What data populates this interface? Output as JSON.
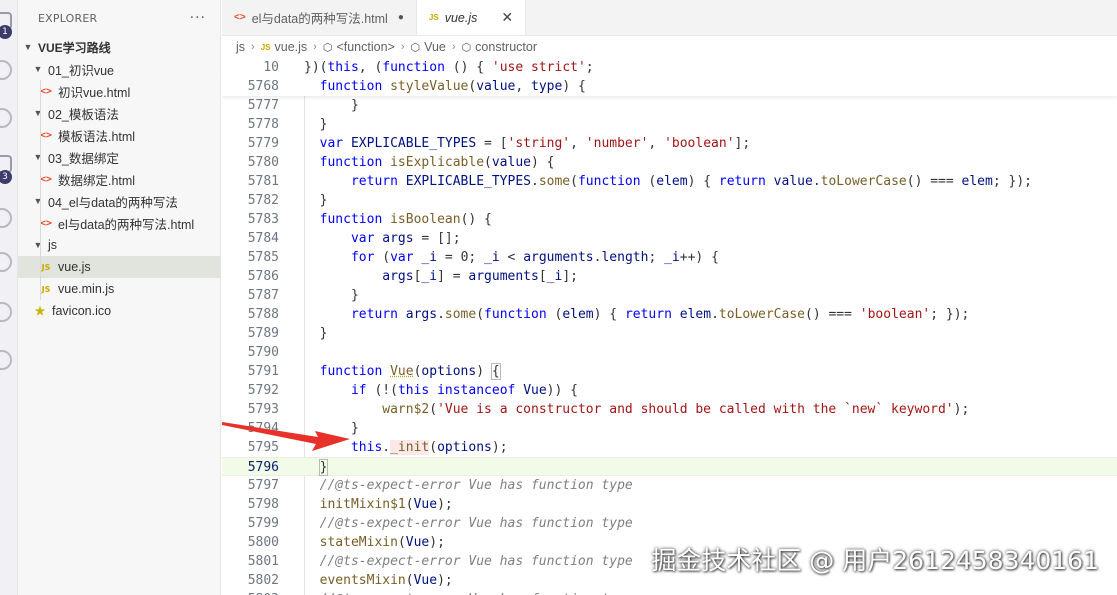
{
  "activity_bar": {
    "badges": [
      "1",
      "3"
    ]
  },
  "explorer": {
    "title": "EXPLORER",
    "more": "···",
    "root": "VUE学习路线",
    "items": [
      {
        "type": "folder",
        "label": "01_初识vue",
        "depth": 1
      },
      {
        "type": "html",
        "label": "初识vue.html",
        "depth": 2
      },
      {
        "type": "folder",
        "label": "02_模板语法",
        "depth": 1
      },
      {
        "type": "html",
        "label": "模板语法.html",
        "depth": 2
      },
      {
        "type": "folder",
        "label": "03_数据绑定",
        "depth": 1
      },
      {
        "type": "html",
        "label": "数据绑定.html",
        "depth": 2
      },
      {
        "type": "folder",
        "label": "04_el与data的两种写法",
        "depth": 1
      },
      {
        "type": "html",
        "label": "el与data的两种写法.html",
        "depth": 2
      },
      {
        "type": "folder",
        "label": "js",
        "depth": 1
      },
      {
        "type": "js",
        "label": "vue.js",
        "depth": 2,
        "selected": true
      },
      {
        "type": "js",
        "label": "vue.min.js",
        "depth": 2
      },
      {
        "type": "star",
        "label": "favicon.ico",
        "depth": 1
      }
    ]
  },
  "tabs": [
    {
      "label": "el与data的两种写法.html",
      "icon": "<>",
      "modified_marker": "●"
    },
    {
      "label": "vue.js",
      "icon": "JS",
      "close": "✕",
      "active": true
    }
  ],
  "breadcrumb": [
    "js",
    "vue.js",
    "<function>",
    "Vue",
    "constructor"
  ],
  "code": {
    "current_line": "5796",
    "lines": [
      {
        "n": "10",
        "t": "})(this, (function () { 'use strict';"
      },
      {
        "n": "5768",
        "t": "  function styleValue(value, type) {"
      },
      {
        "n": "5777",
        "t": "      }"
      },
      {
        "n": "5778",
        "t": "  }"
      },
      {
        "n": "5779",
        "t": "  var EXPLICABLE_TYPES = ['string', 'number', 'boolean'];"
      },
      {
        "n": "5780",
        "t": "  function isExplicable(value) {"
      },
      {
        "n": "5781",
        "t": "      return EXPLICABLE_TYPES.some(function (elem) { return value.toLowerCase() === elem; });"
      },
      {
        "n": "5782",
        "t": "  }"
      },
      {
        "n": "5783",
        "t": "  function isBoolean() {"
      },
      {
        "n": "5784",
        "t": "      var args = [];"
      },
      {
        "n": "5785",
        "t": "      for (var _i = 0; _i < arguments.length; _i++) {"
      },
      {
        "n": "5786",
        "t": "          args[_i] = arguments[_i];"
      },
      {
        "n": "5787",
        "t": "      }"
      },
      {
        "n": "5788",
        "t": "      return args.some(function (elem) { return elem.toLowerCase() === 'boolean'; });"
      },
      {
        "n": "5789",
        "t": "  }"
      },
      {
        "n": "5790",
        "t": ""
      },
      {
        "n": "5791",
        "t": "  function Vue(options) {"
      },
      {
        "n": "5792",
        "t": "      if (!(this instanceof Vue)) {"
      },
      {
        "n": "5793",
        "t": "          warn$2('Vue is a constructor and should be called with the `new` keyword');"
      },
      {
        "n": "5794",
        "t": "      }"
      },
      {
        "n": "5795",
        "t": "      this._init(options);"
      },
      {
        "n": "5796",
        "t": "  }"
      },
      {
        "n": "5797",
        "t": "  //@ts-expect-error Vue has function type"
      },
      {
        "n": "5798",
        "t": "  initMixin$1(Vue);"
      },
      {
        "n": "5799",
        "t": "  //@ts-expect-error Vue has function type"
      },
      {
        "n": "5800",
        "t": "  stateMixin(Vue);"
      },
      {
        "n": "5801",
        "t": "  //@ts-expect-error Vue has function type"
      },
      {
        "n": "5802",
        "t": "  eventsMixin(Vue);"
      },
      {
        "n": "5803",
        "t": "  //@ts-expect-error Vue has function type"
      }
    ]
  },
  "annotation": {
    "arrow_color": "#e8312a",
    "points_to": "this._init(options);"
  },
  "watermark": "掘金技术社区 @ 用户2612458340161",
  "colors": {
    "keyword": "#0000ff",
    "function": "#795e26",
    "string": "#a31515",
    "comment": "#7f7f7f",
    "identifier": "#001080",
    "current_line_bg": "#f2fae8"
  }
}
